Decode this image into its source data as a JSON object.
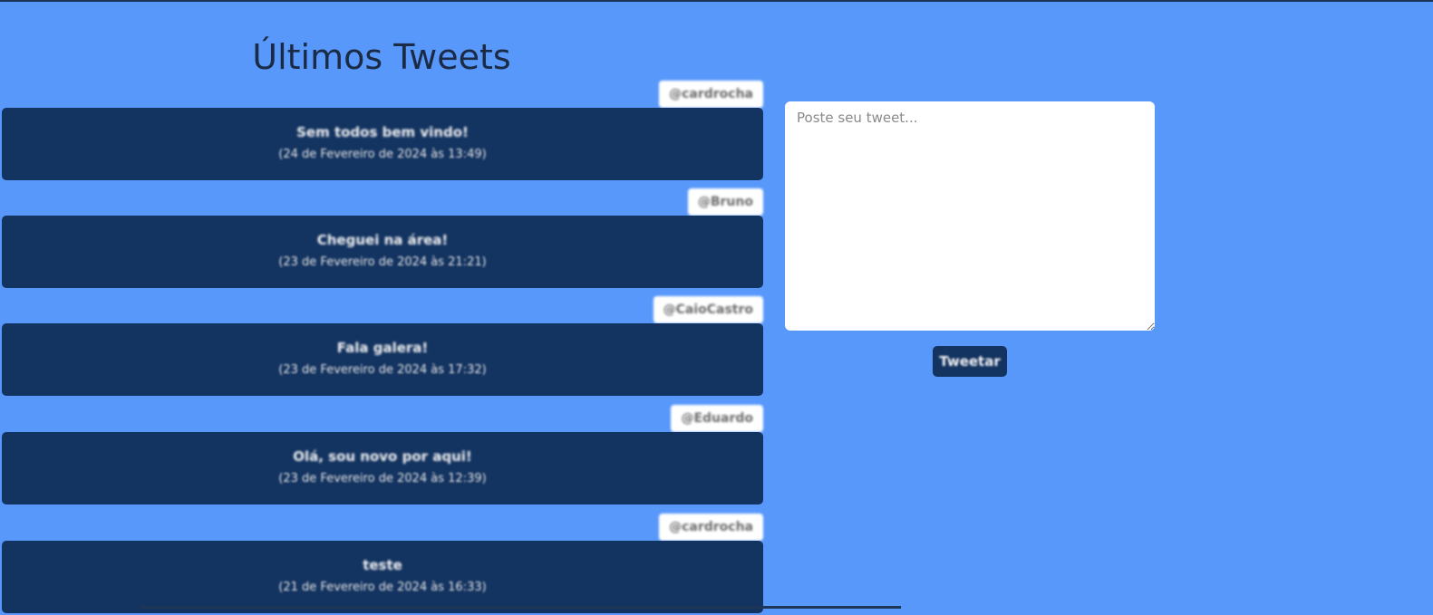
{
  "feed": {
    "title": "Últimos Tweets",
    "tweets": [
      {
        "user": "@cardrocha",
        "text": "Sem todos bem vindo!",
        "date": "(24 de Fevereiro de 2024 às 13:49)"
      },
      {
        "user": "@Bruno",
        "text": "Cheguei na área!",
        "date": "(23 de Fevereiro de 2024 às 21:21)"
      },
      {
        "user": "@CaioCastro",
        "text": "Fala galera!",
        "date": "(23 de Fevereiro de 2024 às 17:32)"
      },
      {
        "user": "@Eduardo",
        "text": "Olá, sou novo por aqui!",
        "date": "(23 de Fevereiro de 2024 às 12:39)"
      },
      {
        "user": "@cardrocha",
        "text": "teste",
        "date": "(21 de Fevereiro de 2024 às 16:33)"
      }
    ]
  },
  "composer": {
    "placeholder": "Poste seu tweet...",
    "value": "",
    "button_label": "Tweetar"
  },
  "colors": {
    "background": "#5898fa",
    "card": "#133360",
    "user_badge": "#ffffff",
    "title": "#1b2a45"
  }
}
